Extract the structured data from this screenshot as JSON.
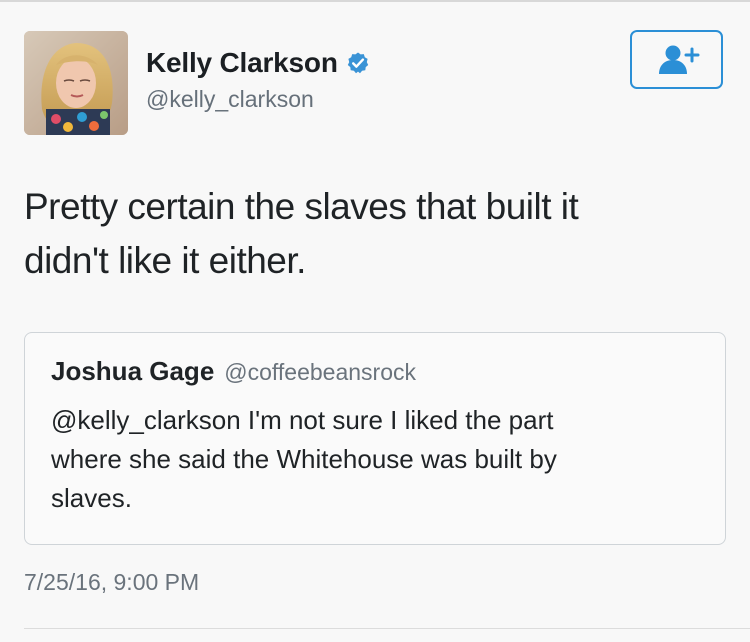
{
  "author": {
    "display_name": "Kelly Clarkson",
    "handle": "@kelly_clarkson",
    "avatar_icon": "profile-photo",
    "verified_icon": "verified-badge-icon",
    "verified_color": "#3a93d6"
  },
  "actions": {
    "follow_icon": "follow-user-icon",
    "accent_color": "#2b8fd6"
  },
  "tweet": {
    "text_line_1": "Pretty certain the slaves that built it",
    "text_line_2": "didn't like it either.",
    "timestamp": "7/25/16, 9:00 PM"
  },
  "quoted_tweet": {
    "display_name": "Joshua Gage",
    "handle": "@coffeebeansrock",
    "text_line_1": "@kelly_clarkson I'm not sure I liked the part",
    "text_line_2": "where she said the Whitehouse was built by",
    "text_line_3": "slaves."
  }
}
